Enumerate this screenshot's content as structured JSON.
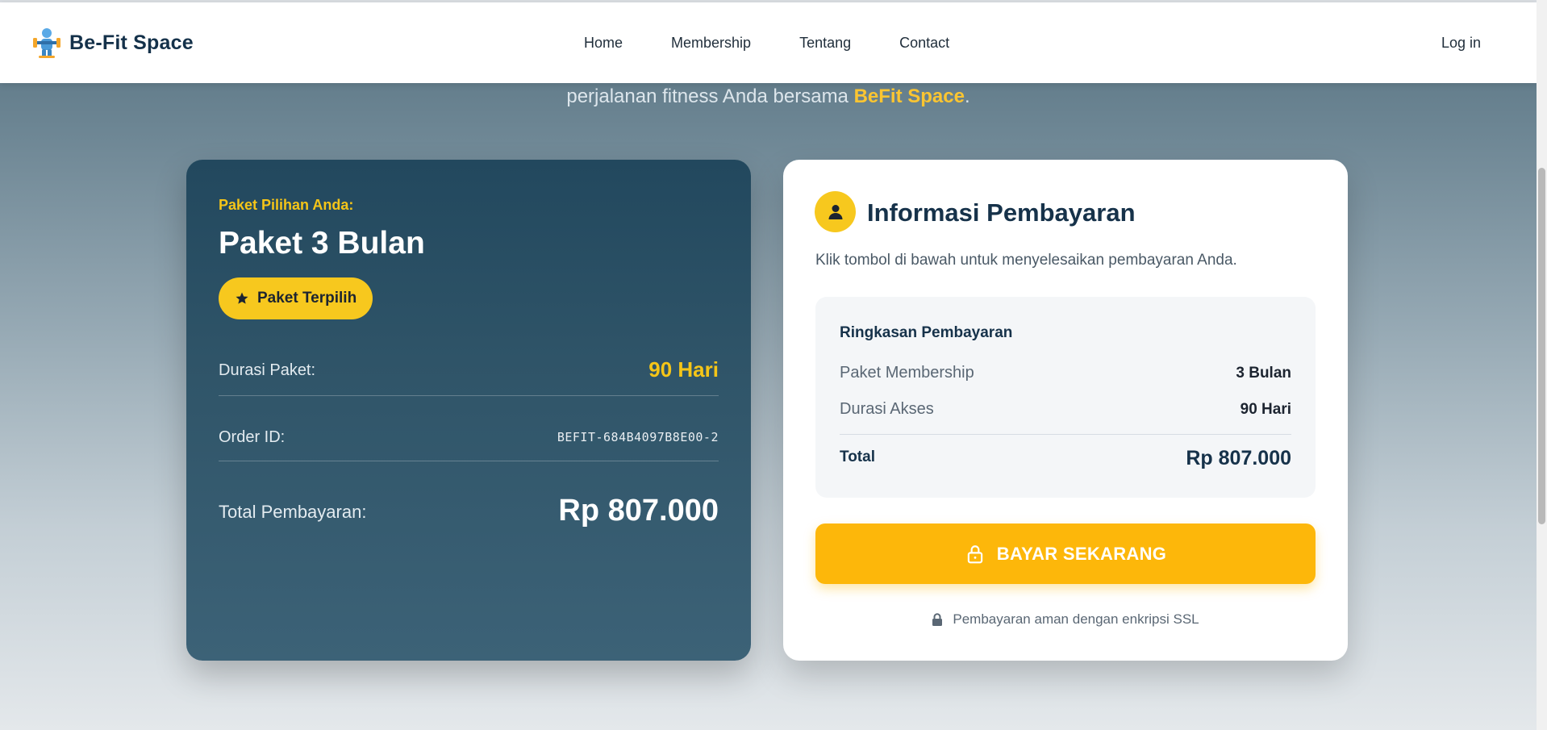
{
  "header": {
    "brand": "Be-Fit Space",
    "nav": [
      "Home",
      "Membership",
      "Tentang",
      "Contact"
    ],
    "login": "Log in"
  },
  "hero": {
    "subtitle_prefix": "perjalanan fitness Anda bersama ",
    "subtitle_highlight": "BeFit Space",
    "subtitle_suffix": "."
  },
  "package_card": {
    "label": "Paket Pilihan Anda:",
    "title": "Paket 3 Bulan",
    "badge": "Paket Terpilih",
    "duration_label": "Durasi Paket:",
    "duration_value": "90 Hari",
    "order_label": "Order ID:",
    "order_value": "BEFIT-684B4097B8E00-2",
    "total_label": "Total Pembayaran:",
    "total_value": "Rp 807.000"
  },
  "payment_card": {
    "title": "Informasi Pembayaran",
    "description": "Klik tombol di bawah untuk menyelesaikan pembayaran Anda.",
    "summary_title": "Ringkasan Pembayaran",
    "rows": [
      {
        "label": "Paket Membership",
        "value": "3 Bulan"
      },
      {
        "label": "Durasi Akses",
        "value": "90 Hari"
      }
    ],
    "total_label": "Total",
    "total_value": "Rp 807.000",
    "pay_button": "BAYAR SEKARANG",
    "secure_note": "Pembayaran aman dengan enkripsi SSL"
  },
  "colors": {
    "accent": "#f7c81e",
    "button": "#fdb70a",
    "card_dark": "#2f5468",
    "brand_text": "#14314a"
  }
}
